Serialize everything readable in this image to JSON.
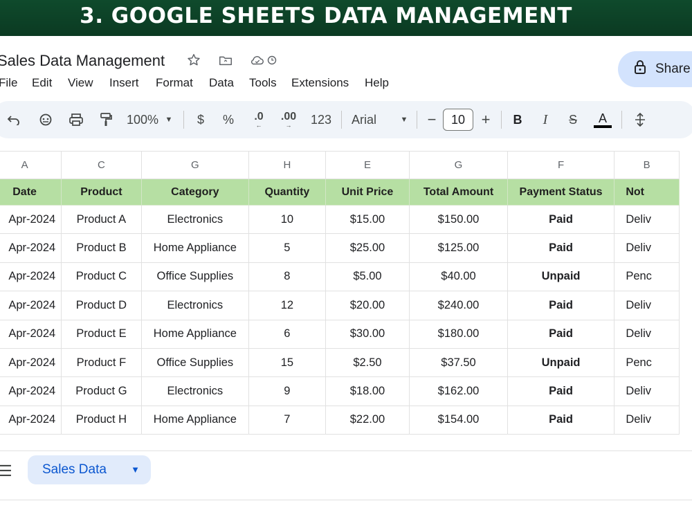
{
  "banner": {
    "title": "3. GOOGLE SHEETS DATA MANAGEMENT"
  },
  "doc": {
    "title": "Sales Data Management",
    "share_label": "Share"
  },
  "menu": [
    "File",
    "Edit",
    "View",
    "Insert",
    "Format",
    "Data",
    "Tools",
    "Extensions",
    "Help"
  ],
  "toolbar": {
    "zoom": "100%",
    "currency": "$",
    "percent": "%",
    "decrease_decimal": ".0",
    "increase_decimal": ".00",
    "number_format": "123",
    "font": "Arial",
    "font_size": "10",
    "minus": "−",
    "plus": "+",
    "bold": "B",
    "italic": "I",
    "strike": "S",
    "text_color": "A"
  },
  "grid": {
    "column_letters": [
      "A",
      "C",
      "G",
      "H",
      "E",
      "G",
      "F",
      "B"
    ],
    "headers": [
      "Date",
      "Product",
      "Category",
      "Quantity",
      "Unit Price",
      "Total Amount",
      "Payment Status",
      "Not"
    ],
    "rows": [
      [
        "Apr-2024",
        "Product A",
        "Electronics",
        "10",
        "$15.00",
        "$150.00",
        "Paid",
        "Deliv"
      ],
      [
        "Apr-2024",
        "Product B",
        "Home Appliance",
        "5",
        "$25.00",
        "$125.00",
        "Paid",
        "Deliv"
      ],
      [
        "Apr-2024",
        "Product C",
        "Office Supplies",
        "8",
        "$5.00",
        "$40.00",
        "Unpaid",
        "Penc"
      ],
      [
        "Apr-2024",
        "Product D",
        "Electronics",
        "12",
        "$20.00",
        "$240.00",
        "Paid",
        "Deliv"
      ],
      [
        "Apr-2024",
        "Product E",
        "Home Appliance",
        "6",
        "$30.00",
        "$180.00",
        "Paid",
        "Deliv"
      ],
      [
        "Apr-2024",
        "Product F",
        "Office Supplies",
        "15",
        "$2.50",
        "$37.50",
        "Unpaid",
        "Penc"
      ],
      [
        "Apr-2024",
        "Product G",
        "Electronics",
        "9",
        "$18.00",
        "$162.00",
        "Paid",
        "Deliv"
      ],
      [
        "Apr-2024",
        "Product H",
        "Home Appliance",
        "7",
        "$22.00",
        "$154.00",
        "Paid",
        "Deliv"
      ]
    ]
  },
  "sheet_tabs": {
    "active": "Sales Data"
  },
  "colors": {
    "banner": "#0f4a2c",
    "header_fill": "#b6dfa3",
    "paid": "#1e8a32",
    "unpaid": "#e02020",
    "share_bg": "#d3e3fd",
    "tab_text": "#0b57d0"
  }
}
